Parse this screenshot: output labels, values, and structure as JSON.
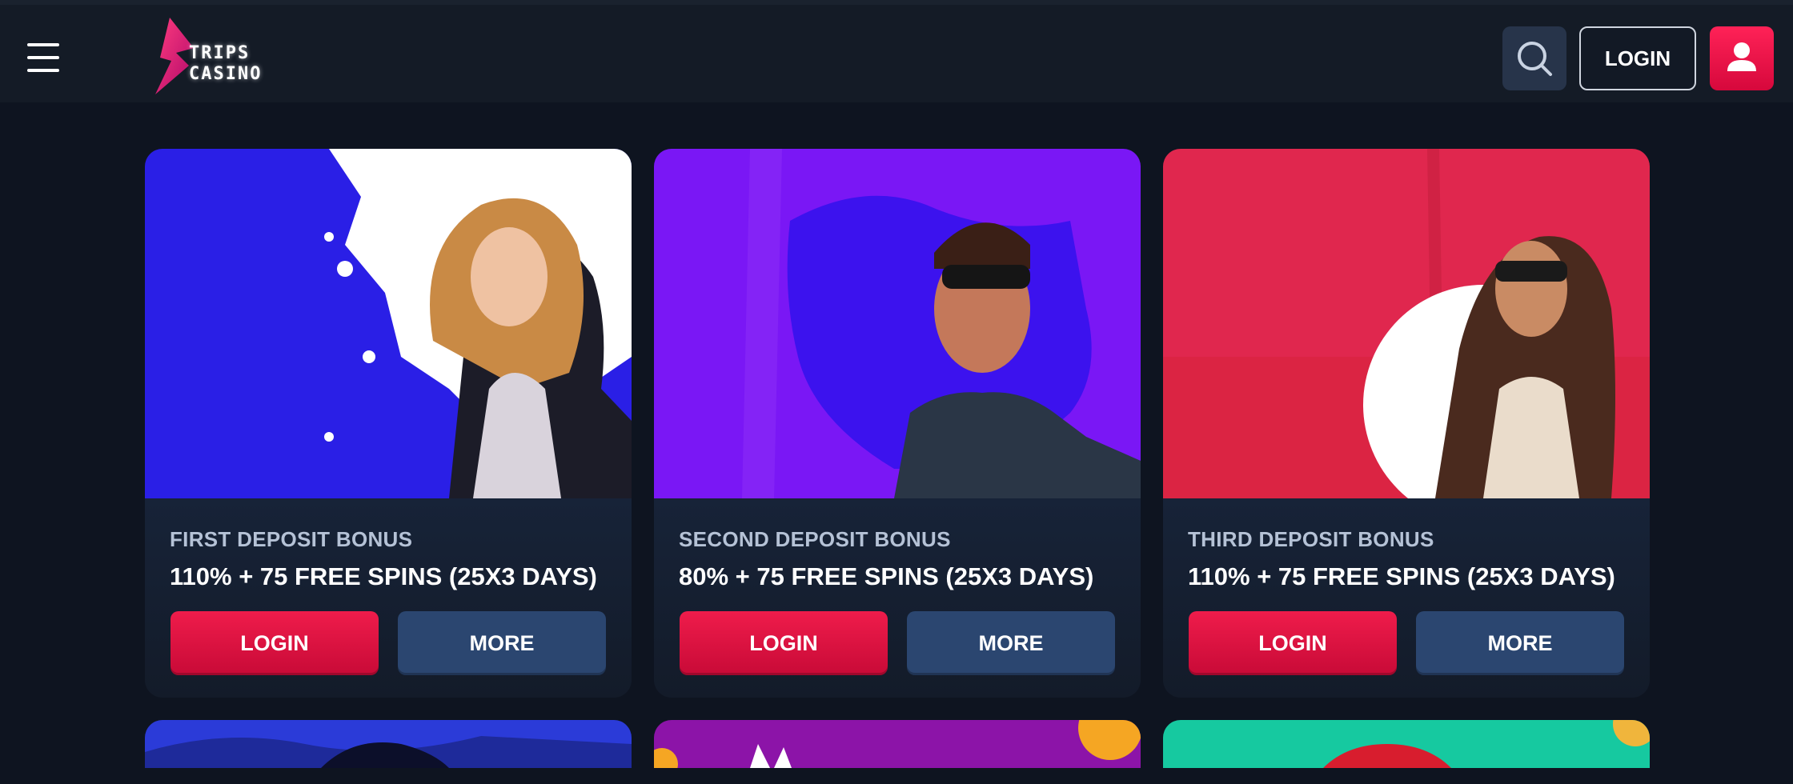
{
  "header": {
    "menu_icon": "hamburger-icon",
    "logo_text": "TRIPS\nCASINO",
    "search_icon": "search-icon",
    "login_label": "LOGIN",
    "user_icon": "user-icon",
    "colors": {
      "bg": "#141b26",
      "accent": "#e8123f",
      "search_bg": "#27344a"
    }
  },
  "cards": [
    {
      "subtitle": "FIRST DEPOSIT BONUS",
      "title": "110% + 75 FREE SPINS (25X3 DAYS)",
      "login_label": "LOGIN",
      "more_label": "MORE",
      "art_bg": "#2a1fe6"
    },
    {
      "subtitle": "SECOND DEPOSIT BONUS",
      "title": "80% + 75 FREE SPINS (25X3 DAYS)",
      "login_label": "LOGIN",
      "more_label": "MORE",
      "art_bg": "#7a17f5"
    },
    {
      "subtitle": "THIRD DEPOSIT BONUS",
      "title": "110% + 75 FREE SPINS (25X3 DAYS)",
      "login_label": "LOGIN",
      "more_label": "MORE",
      "art_bg": "#e0274e"
    }
  ],
  "colors": {
    "page_bg": "#0e1420",
    "card_bg": "#131b29",
    "login_btn": "#e8123f",
    "more_btn": "#2b4670"
  }
}
